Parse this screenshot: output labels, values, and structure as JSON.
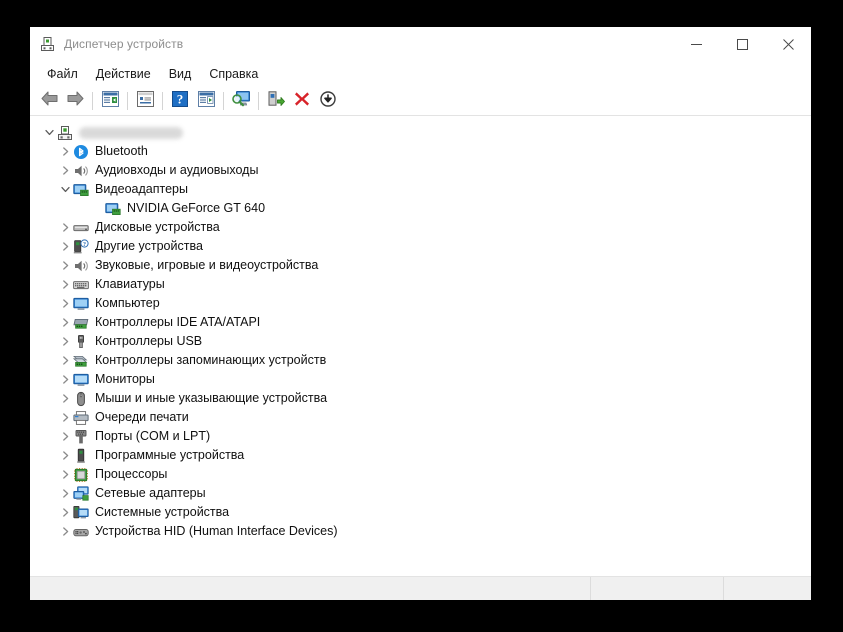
{
  "window": {
    "title": "Диспетчер устройств",
    "icon": "device-manager-icon",
    "controls": {
      "minimize": "minimize-icon",
      "maximize": "maximize-icon",
      "close": "close-icon"
    }
  },
  "menubar": {
    "items": [
      {
        "label": "Файл",
        "name": "menu-file"
      },
      {
        "label": "Действие",
        "name": "menu-action"
      },
      {
        "label": "Вид",
        "name": "menu-view"
      },
      {
        "label": "Справка",
        "name": "menu-help"
      }
    ]
  },
  "toolbar": {
    "buttons": [
      {
        "name": "back-button",
        "icon": "back-arrow-icon"
      },
      {
        "name": "forward-button",
        "icon": "forward-arrow-icon"
      },
      {
        "name": "show-hide-console-tree-button",
        "icon": "console-tree-icon"
      },
      {
        "name": "properties-button",
        "icon": "properties-icon"
      },
      {
        "name": "help-button",
        "icon": "help-question-icon"
      },
      {
        "name": "show-hide-action-pane-button",
        "icon": "action-pane-icon"
      },
      {
        "name": "scan-for-hardware-changes-button",
        "icon": "scan-hardware-icon"
      },
      {
        "name": "update-driver-button",
        "icon": "update-driver-icon"
      },
      {
        "name": "uninstall-device-button",
        "icon": "red-x-icon"
      },
      {
        "name": "disable-device-button",
        "icon": "down-arrow-circle-icon"
      }
    ]
  },
  "tree": {
    "root": {
      "label": "",
      "redacted": true,
      "icon": "computer-node-icon",
      "expanded": true
    },
    "items": [
      {
        "label": "Bluetooth",
        "icon": "bluetooth-icon",
        "expandable": true,
        "expanded": false,
        "level": 1
      },
      {
        "label": "Аудиовходы и аудиовыходы",
        "icon": "audio-io-icon",
        "expandable": true,
        "expanded": false,
        "level": 1
      },
      {
        "label": "Видеоадаптеры",
        "icon": "display-adapter-icon",
        "expandable": true,
        "expanded": true,
        "level": 1
      },
      {
        "label": "NVIDIA GeForce GT 640",
        "icon": "display-adapter-icon",
        "expandable": false,
        "expanded": false,
        "level": 2
      },
      {
        "label": "Дисковые устройства",
        "icon": "disk-drive-icon",
        "expandable": true,
        "expanded": false,
        "level": 1
      },
      {
        "label": "Другие устройства",
        "icon": "other-devices-icon",
        "expandable": true,
        "expanded": false,
        "level": 1
      },
      {
        "label": "Звуковые, игровые и видеоустройства",
        "icon": "sound-video-icon",
        "expandable": true,
        "expanded": false,
        "level": 1
      },
      {
        "label": "Клавиатуры",
        "icon": "keyboard-icon",
        "expandable": true,
        "expanded": false,
        "level": 1
      },
      {
        "label": "Компьютер",
        "icon": "computer-icon",
        "expandable": true,
        "expanded": false,
        "level": 1
      },
      {
        "label": "Контроллеры IDE ATA/ATAPI",
        "icon": "ide-controller-icon",
        "expandable": true,
        "expanded": false,
        "level": 1
      },
      {
        "label": "Контроллеры USB",
        "icon": "usb-controller-icon",
        "expandable": true,
        "expanded": false,
        "level": 1
      },
      {
        "label": "Контроллеры запоминающих устройств",
        "icon": "storage-controller-icon",
        "expandable": true,
        "expanded": false,
        "level": 1
      },
      {
        "label": "Мониторы",
        "icon": "monitor-icon",
        "expandable": true,
        "expanded": false,
        "level": 1
      },
      {
        "label": "Мыши и иные указывающие устройства",
        "icon": "mouse-icon",
        "expandable": true,
        "expanded": false,
        "level": 1
      },
      {
        "label": "Очереди печати",
        "icon": "printer-icon",
        "expandable": true,
        "expanded": false,
        "level": 1
      },
      {
        "label": "Порты (COM и LPT)",
        "icon": "port-icon",
        "expandable": true,
        "expanded": false,
        "level": 1
      },
      {
        "label": "Программные устройства",
        "icon": "software-device-icon",
        "expandable": true,
        "expanded": false,
        "level": 1
      },
      {
        "label": "Процессоры",
        "icon": "processor-icon",
        "expandable": true,
        "expanded": false,
        "level": 1
      },
      {
        "label": "Сетевые адаптеры",
        "icon": "network-adapter-icon",
        "expandable": true,
        "expanded": false,
        "level": 1
      },
      {
        "label": "Системные устройства",
        "icon": "system-device-icon",
        "expandable": true,
        "expanded": false,
        "level": 1
      },
      {
        "label": "Устройства HID (Human Interface Devices)",
        "icon": "hid-device-icon",
        "expandable": true,
        "expanded": false,
        "level": 1
      }
    ]
  },
  "statusbar": {
    "main": "",
    "middle": "",
    "right": ""
  },
  "colors": {
    "window_bg": "#ffffff",
    "page_bg": "#000000",
    "title_text": "#8d8d8d",
    "tree_text": "#101010",
    "statusbar_bg": "#f0f0f0",
    "accent_red": "#d31f28",
    "accent_blue": "#1f7fd4",
    "accent_green": "#3a9a2e"
  }
}
